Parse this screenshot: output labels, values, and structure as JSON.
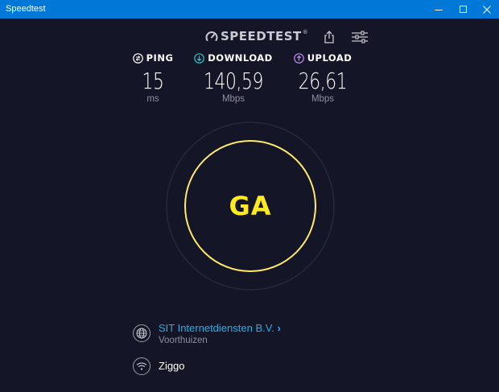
{
  "window": {
    "title": "Speedtest"
  },
  "header": {
    "logo_text": "SPEEDTEST",
    "logo_mark": "®",
    "share_icon": "share-icon",
    "settings_icon": "settings-sliders-icon"
  },
  "metrics": {
    "ping": {
      "label": "PING",
      "value": "15",
      "unit": "ms",
      "icon": "ping-icon"
    },
    "download": {
      "label": "DOWNLOAD",
      "value": "140,59",
      "unit": "Mbps",
      "icon": "download-arrow-icon"
    },
    "upload": {
      "label": "UPLOAD",
      "value": "26,61",
      "unit": "Mbps",
      "icon": "upload-arrow-icon"
    }
  },
  "go_button": {
    "label": "GA"
  },
  "server": {
    "name": "SIT Internetdiensten B.V.",
    "chevron": "›",
    "location": "Voorthuizen",
    "icon": "globe-icon"
  },
  "connection": {
    "name": "Ziggo",
    "icon": "wifi-icon"
  },
  "colors": {
    "titlebar": "#0078d7",
    "background": "#141526",
    "accent_yellow": "#ffea1f",
    "link_blue": "#23b0e8",
    "ping_icon": "#ffffff",
    "download_icon": "#1fc8c8",
    "upload_icon": "#c08bf0"
  }
}
